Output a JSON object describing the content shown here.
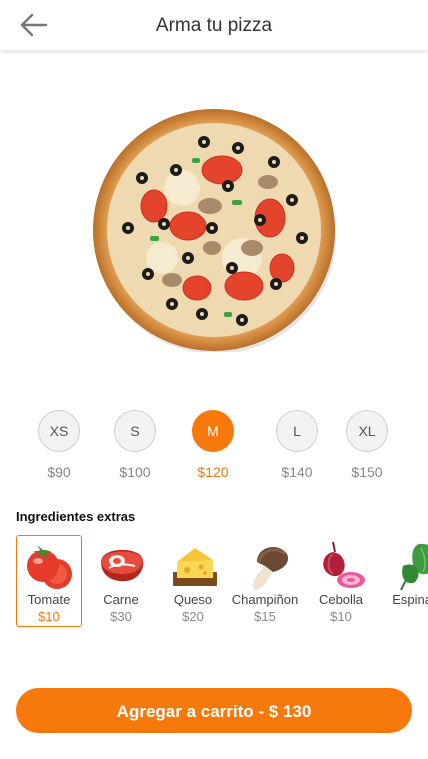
{
  "header": {
    "title": "Arma tu pizza",
    "back_icon": "arrow-left-icon"
  },
  "colors": {
    "accent": "#f7790b"
  },
  "sizes": [
    {
      "label": "XS",
      "price": "$90",
      "selected": false
    },
    {
      "label": "S",
      "price": "$100",
      "selected": false
    },
    {
      "label": "M",
      "price": "$120",
      "selected": true
    },
    {
      "label": "L",
      "price": "$140",
      "selected": false
    },
    {
      "label": "XL",
      "price": "$150",
      "selected": false
    }
  ],
  "extras": {
    "title": "Ingredientes extras",
    "items": [
      {
        "name": "Tomate",
        "price": "$10",
        "icon": "tomato-icon",
        "selected": true
      },
      {
        "name": "Carne",
        "price": "$30",
        "icon": "steak-icon",
        "selected": false
      },
      {
        "name": "Queso",
        "price": "$20",
        "icon": "cheese-icon",
        "selected": false
      },
      {
        "name": "Champiñon",
        "price": "$15",
        "icon": "mushroom-icon",
        "selected": false
      },
      {
        "name": "Cebolla",
        "price": "$10",
        "icon": "onion-icon",
        "selected": false
      },
      {
        "name": "Espinaca",
        "price": "",
        "icon": "spinach-icon",
        "selected": false
      }
    ]
  },
  "cart_button": {
    "label": "Agregar a carrito - $ 130"
  }
}
